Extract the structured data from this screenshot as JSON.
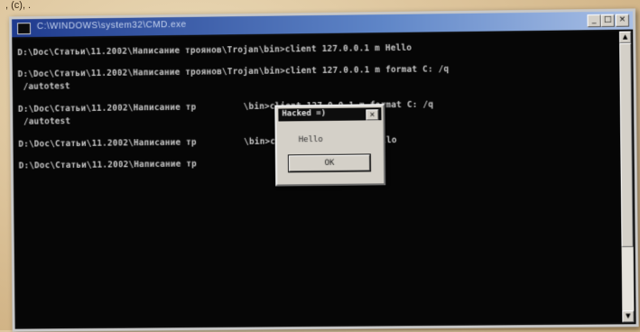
{
  "page_caption": ", (c), .",
  "window": {
    "title": "C:\\WINDOWS\\system32\\CMD.exe",
    "minimize_glyph": "_",
    "maximize_glyph": "□",
    "close_glyph": "×"
  },
  "console": {
    "lines": [
      "D:\\Doc\\Статьи\\11.2002\\Написание троянов\\Trojan\\bin>client 127.0.0.1 m Hello",
      "D:\\Doc\\Статьи\\11.2002\\Написание троянов\\Trojan\\bin>client 127.0.0.1 m format C: /q",
      " /autotest",
      "D:\\Doc\\Статьи\\11.2002\\Написание тр         \\bin>client 127.0.0.1 m format C: /q",
      " /autotest",
      "D:\\Doc\\Статьи\\11.2002\\Написание тр         \\bin>client 127.0.0.1 m Hello",
      "D:\\Doc\\Статьи\\11.2002\\Написание тр"
    ]
  },
  "dialog": {
    "title": "Hacked =)",
    "close_glyph": "×",
    "message": "Hello",
    "ok_label": "OK"
  },
  "scrollbar": {
    "up_glyph": "▲",
    "down_glyph": "▼"
  }
}
